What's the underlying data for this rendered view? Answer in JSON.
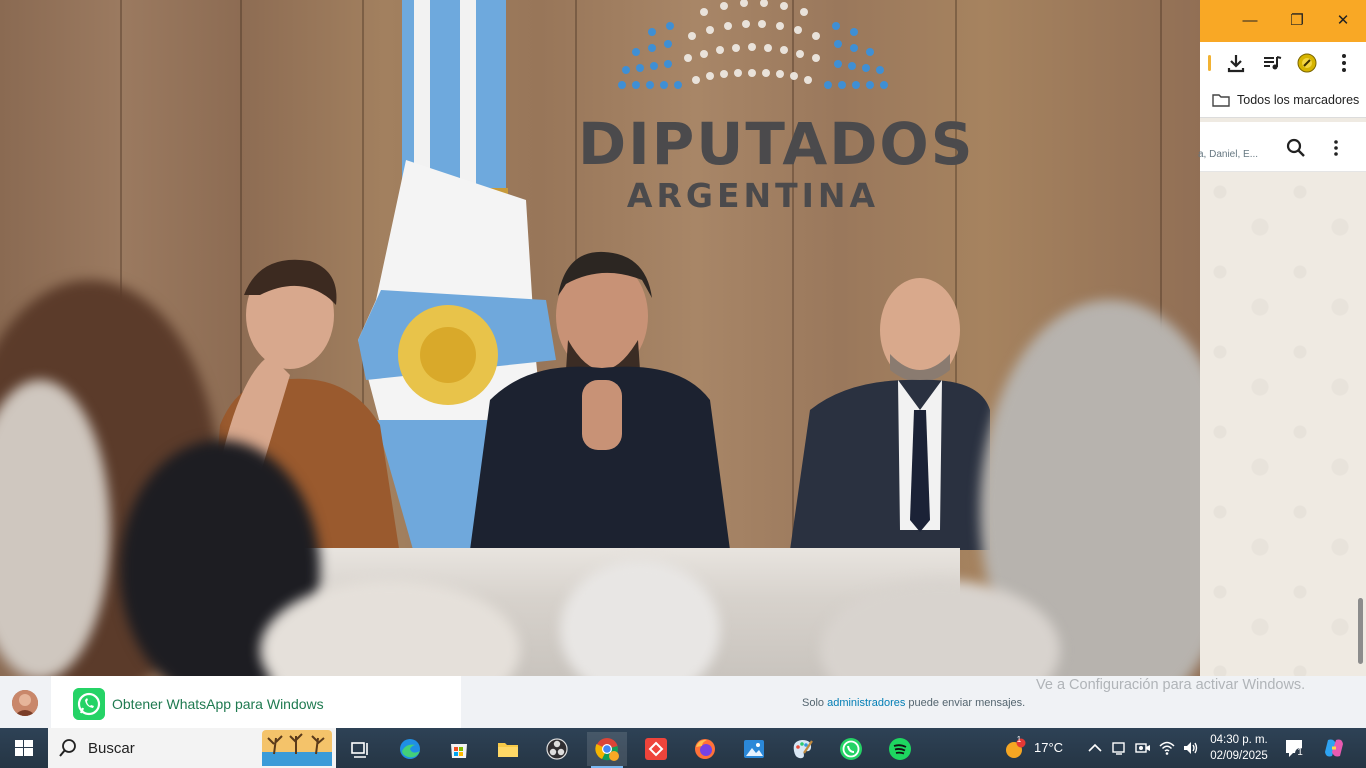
{
  "photo": {
    "wordmark_line1": "DIPUTADOS",
    "wordmark_line2": "ARGENTINA"
  },
  "window": {
    "minimize": "—",
    "restore": "❐",
    "close": "✕"
  },
  "bookmarks": {
    "label": "Todos los marcadores"
  },
  "chat": {
    "members": "a, Daniel, E..."
  },
  "whatsapp": {
    "promo_text": "Obtener WhatsApp para Windows",
    "message_prefix": "Solo",
    "message_link": "administradores",
    "message_suffix": "puede enviar mensajes.",
    "watermark": "Ve a Configuración para activar Windows."
  },
  "taskbar": {
    "search_label": "Buscar",
    "temperature": "17°C",
    "weather_badge": "1",
    "time": "04:30 p. m.",
    "date": "02/09/2025",
    "notification_count": "1"
  },
  "colors": {
    "titlebar": "#f9a825",
    "whatsapp_green": "#25d366",
    "taskbar": "#2b3a4a"
  }
}
